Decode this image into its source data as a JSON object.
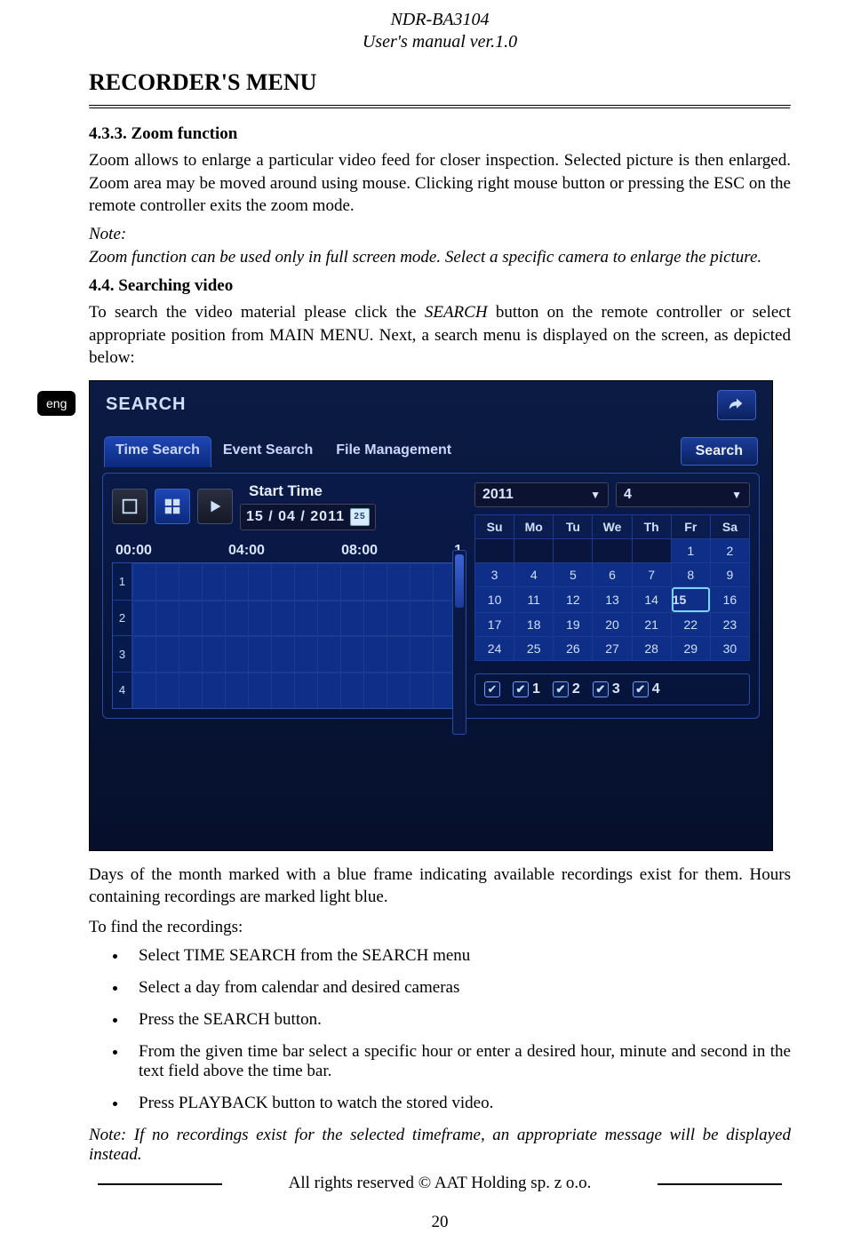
{
  "header": {
    "model": "NDR-BA3104",
    "subtitle": "User's manual ver.1.0"
  },
  "title": "RECORDER'S MENU",
  "lang_tab": "eng",
  "s433_head": "4.3.3. Zoom function",
  "s433_body": "Zoom allows to enlarge a particular video feed for closer inspection. Selected picture is then enlarged. Zoom area may be moved around using mouse. Clicking right mouse button or pressing the ESC on the remote controller exits the zoom mode.",
  "note_label": "Note:",
  "s433_note": "Zoom function can be used only in full screen mode. Select a specific camera to enlarge the picture.",
  "s44_head": "4.4. Searching video",
  "s44_body_a": "To search the video material please click the ",
  "s44_body_em": "SEARCH",
  "s44_body_b": " button on the remote controller or select appropriate position from MAIN MENU. Next, a search menu is displayed on the screen, as depicted below:",
  "dvr": {
    "title": "SEARCH",
    "tabs": [
      "Time Search",
      "Event Search",
      "File Management"
    ],
    "search_btn": "Search",
    "start_label": "Start Time",
    "start_date": "15 / 04 / 2011",
    "cal_badge": "25",
    "ruler": [
      "00:00",
      "04:00",
      "08:00",
      "1"
    ],
    "channels": [
      "1",
      "2",
      "3",
      "4"
    ],
    "year": "2011",
    "month": "4",
    "dow": [
      "Su",
      "Mo",
      "Tu",
      "We",
      "Th",
      "Fr",
      "Sa"
    ],
    "weeks": [
      [
        "",
        "",
        "",
        "",
        "",
        "1",
        "2"
      ],
      [
        "3",
        "4",
        "5",
        "6",
        "7",
        "8",
        "9"
      ],
      [
        "10",
        "11",
        "12",
        "13",
        "14",
        "15",
        "16"
      ],
      [
        "17",
        "18",
        "19",
        "20",
        "21",
        "22",
        "23"
      ],
      [
        "24",
        "25",
        "26",
        "27",
        "28",
        "29",
        "30"
      ]
    ],
    "selected_day": "15",
    "cams": [
      "1",
      "2",
      "3",
      "4"
    ]
  },
  "after_img": "Days of the month marked with a blue frame indicating available recordings exist for them. Hours containing recordings are marked light blue.",
  "find_intro": "To find the recordings:",
  "bullets": [
    "Select TIME SEARCH from the SEARCH menu",
    "Select a day from calendar and desired cameras",
    "Press the SEARCH  button.",
    "From the given time bar select a specific hour or enter a desired hour, minute and second in the text field above the time bar.",
    "Press PLAYBACK button to watch the stored video."
  ],
  "bottom_note": "Note: If no recordings exist for the selected timeframe, an appropriate message will be displayed instead.",
  "copyright": "All rights reserved © AAT Holding sp. z o.o.",
  "page_number": "20"
}
